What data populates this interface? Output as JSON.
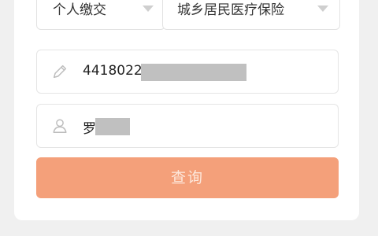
{
  "filters": {
    "payer_type": {
      "value": "个人缴交"
    },
    "insurance_type": {
      "value": "城乡居民医疗保险"
    }
  },
  "form": {
    "id_number": {
      "value": "4418022"
    },
    "name": {
      "value": "罗"
    }
  },
  "actions": {
    "query_label": "查询"
  },
  "icons": {
    "id_field": "pencil-icon",
    "name_field": "user-icon",
    "dropdown": "chevron-down-icon"
  },
  "colors": {
    "primary_button": "#f4a07a",
    "button_text": "#fde8dc",
    "border": "#e3e3e3"
  }
}
